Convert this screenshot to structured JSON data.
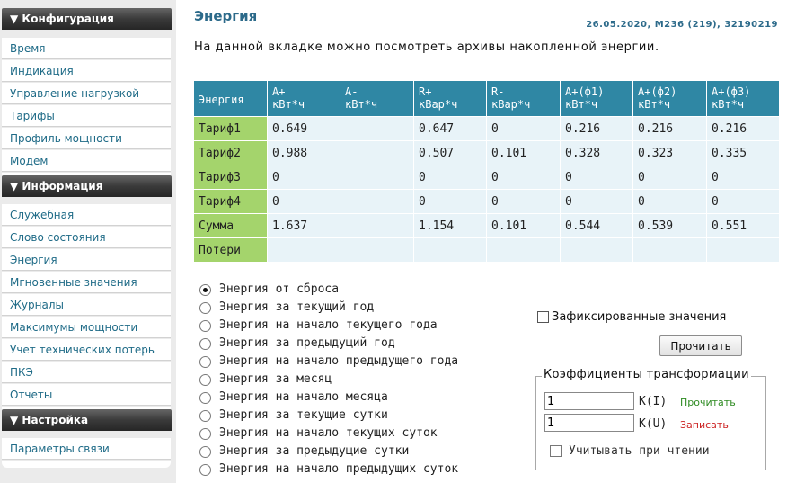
{
  "sidebar": {
    "sections": [
      {
        "title": "▼ Конфигурация",
        "items": [
          "Время",
          "Индикация",
          "Управление нагрузкой",
          "Тарифы",
          "Профиль мощности",
          "Модем"
        ]
      },
      {
        "title": "▼ Информация",
        "items": [
          "Служебная",
          "Слово состояния",
          "Энергия",
          "Мгновенные значения",
          "Журналы",
          "Максимумы мощности",
          "Учет технических потерь",
          "ПКЭ",
          "Отчеты"
        ]
      },
      {
        "title": "▼ Настройка",
        "items": [
          "Параметры связи"
        ]
      }
    ]
  },
  "header": {
    "title": "Энергия",
    "info": "26.05.2020, M236 (219), 32190219",
    "description": "На данной вкладке можно посмотреть архивы накопленной энергии."
  },
  "table": {
    "corner": "Энергия",
    "columns": [
      [
        "A+",
        "кВт*ч"
      ],
      [
        "A-",
        "кВт*ч"
      ],
      [
        "R+",
        "кВар*ч"
      ],
      [
        "R-",
        "кВар*ч"
      ],
      [
        "A+(ф1)",
        "кВт*ч"
      ],
      [
        "A+(ф2)",
        "кВт*ч"
      ],
      [
        "A+(ф3)",
        "кВт*ч"
      ]
    ],
    "rows": [
      {
        "label": "Тариф1",
        "cells": [
          "0.649",
          "",
          "0.647",
          "0",
          "0.216",
          "0.216",
          "0.216"
        ]
      },
      {
        "label": "Тариф2",
        "cells": [
          "0.988",
          "",
          "0.507",
          "0.101",
          "0.328",
          "0.323",
          "0.335"
        ]
      },
      {
        "label": "Тариф3",
        "cells": [
          "0",
          "",
          "0",
          "0",
          "0",
          "0",
          "0"
        ]
      },
      {
        "label": "Тариф4",
        "cells": [
          "0",
          "",
          "0",
          "0",
          "0",
          "0",
          "0"
        ]
      },
      {
        "label": "Сумма",
        "cells": [
          "1.637",
          "",
          "1.154",
          "0.101",
          "0.544",
          "0.539",
          "0.551"
        ]
      },
      {
        "label": "Потери",
        "cells": [
          "",
          "",
          "",
          "",
          "",
          "",
          ""
        ]
      }
    ]
  },
  "period_options": {
    "selected": 0,
    "items": [
      "Энергия от сброса",
      "Энергия за текущий год",
      "Энергия на начало текущего года",
      "Энергия за предыдущий год",
      "Энергия на начало предыдущего года",
      "Энергия за месяц",
      "Энергия на начало месяца",
      "Энергия за текущие сутки",
      "Энергия на начало текущих суток",
      "Энергия за предыдущие сутки",
      "Энергия на начало предыдущих суток"
    ]
  },
  "controls": {
    "fixed_values_label": "Зафиксированные значения",
    "fixed_values_checked": false,
    "read_button": "Прочитать"
  },
  "transform": {
    "legend": "Коэффициенты трансформации",
    "ki_value": "1",
    "ki_label": "K(I)",
    "ku_value": "1",
    "ku_label": "K(U)",
    "read_link": "Прочитать",
    "write_link": "Записать",
    "apply_label": "Учитывать при чтении",
    "apply_checked": false
  },
  "colors": {
    "header_blue": "#2f87a4",
    "row_green": "#a4d46c",
    "link_teal": "#1f6b87",
    "read_green": "#2e8b22",
    "write_red": "#cc2222"
  }
}
